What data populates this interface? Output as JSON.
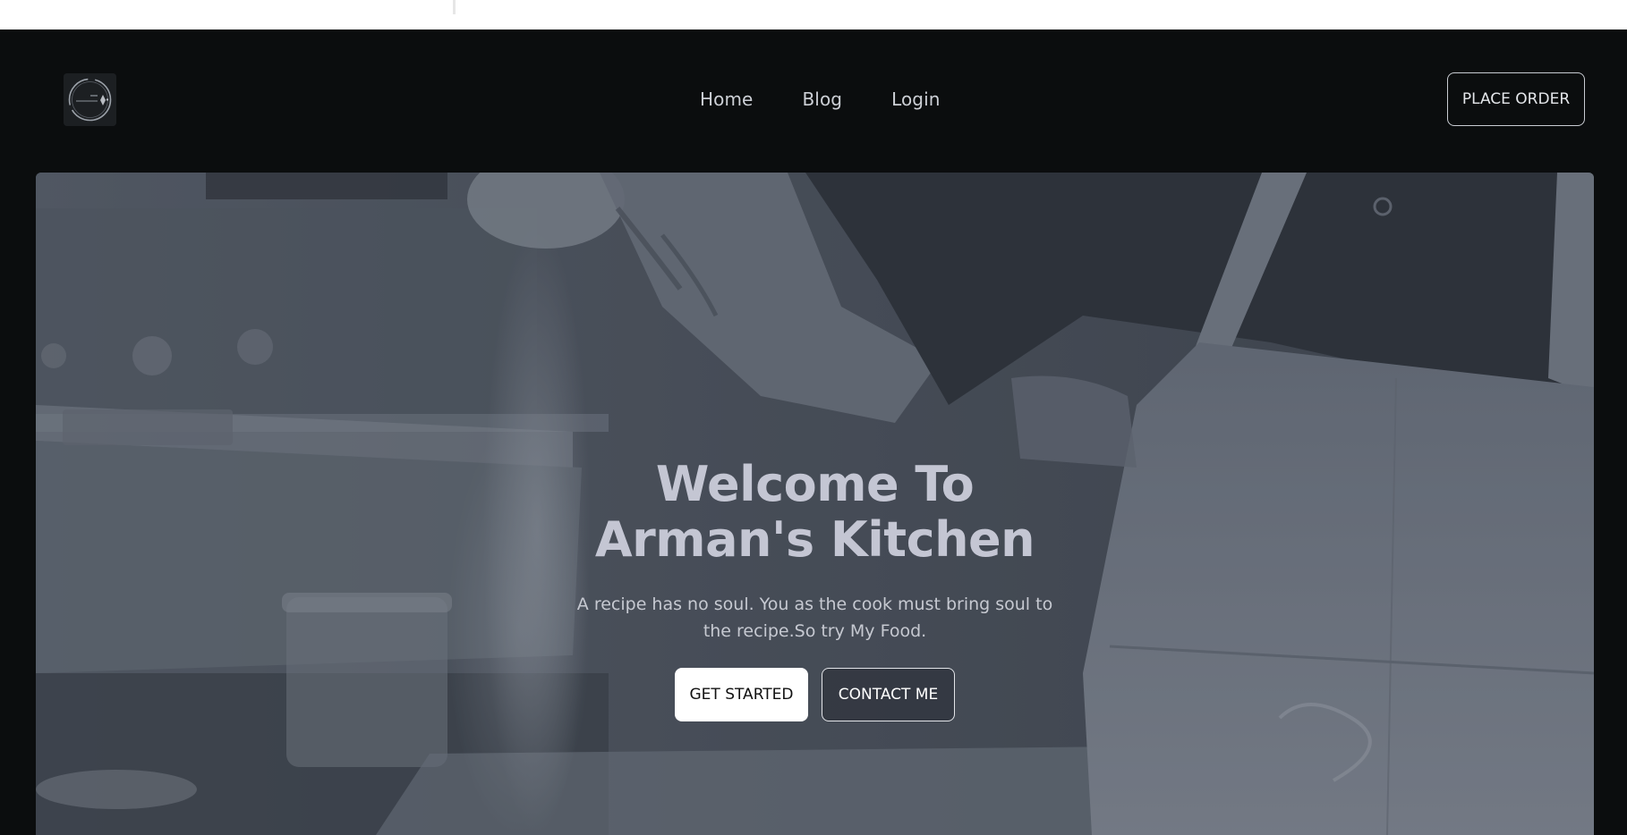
{
  "nav": {
    "logo_icon": "kitchen-logo-icon",
    "links": [
      {
        "label": "Home"
      },
      {
        "label": "Blog"
      },
      {
        "label": "Login"
      }
    ],
    "order_button": "PLACE ORDER"
  },
  "hero": {
    "background": "chef-sprinkling-flour-photo",
    "title_line1": "Welcome To",
    "title_line2": "Arman's Kitchen",
    "subtitle": "A recipe has no soul. You as the cook must bring soul to the recipe.So try My Food.",
    "primary_button": "GET STARTED",
    "secondary_button": "CONTACT ME"
  },
  "colors": {
    "page_background": "#0b0d0e",
    "hero_tint": "#4c535d",
    "title_text": "#c4c6d3",
    "primary_button_bg": "#ffffff"
  }
}
